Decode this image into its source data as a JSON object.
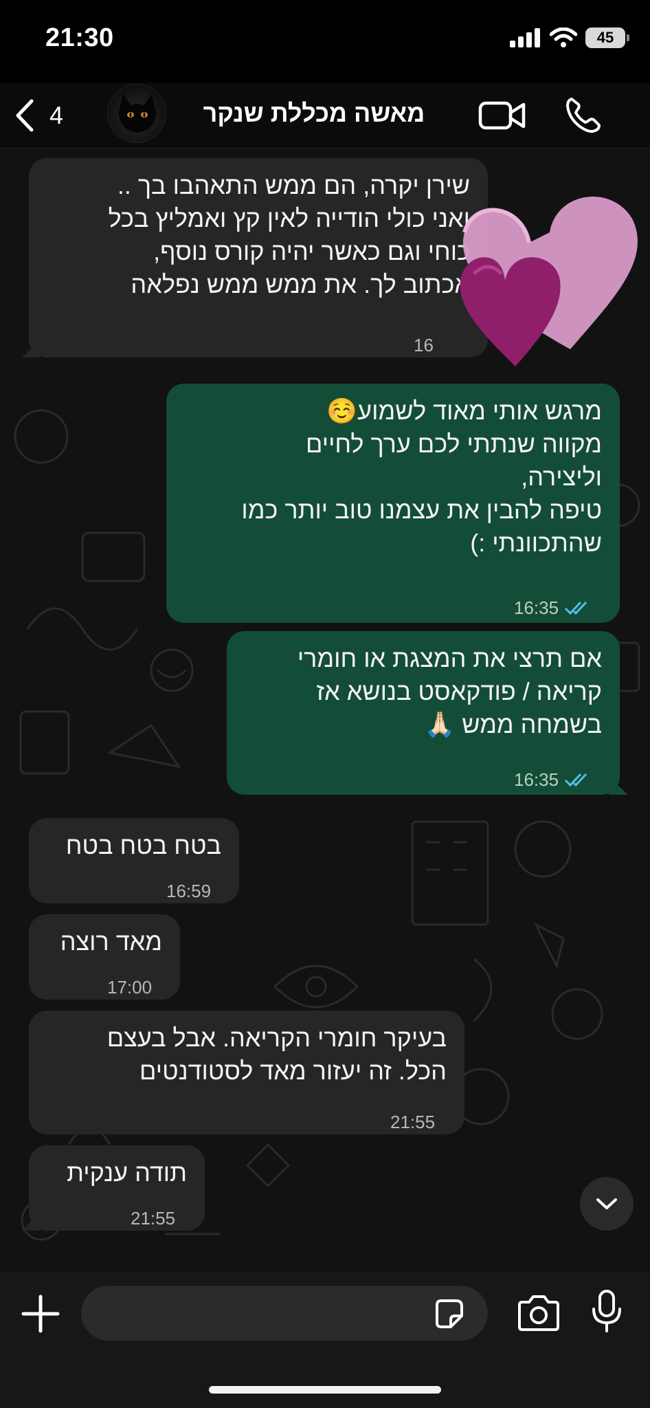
{
  "status_bar": {
    "time": "21:30",
    "battery": "45",
    "icons": [
      "signal-icon",
      "wifi-icon",
      "battery-icon"
    ]
  },
  "header": {
    "back_count": "4",
    "contact_name": "מאשה מכללת שנקר",
    "icons": [
      "chevron-left-icon",
      "video-call-icon",
      "phone-icon"
    ]
  },
  "messages": [
    {
      "direction": "in",
      "lines": [
        "שירן יקרה, הם ממש התאהבו בך ..",
        "ואני כולי הודייה לאין קץ ואמליץ בכל",
        "כוחי וגם כאשר יהיה קורס נוסף,",
        "אכתוב לך. את ממש ממש נפלאה"
      ],
      "time": "16"
    },
    {
      "direction": "out",
      "lines": [
        "מרגש אותי מאוד לשמוע☺️",
        "מקווה שנתתי לכם ערך לחיים",
        "וליצירה,",
        "טיפה להבין את עצמנו טוב יותר כמו",
        "שהתכוונתי :)"
      ],
      "time": "16:35",
      "status": "read"
    },
    {
      "direction": "out",
      "lines": [
        "אם תרצי את המצגת או חומרי",
        "קריאה / פודקאסט בנושא אז",
        "בשמחה ממש 🙏🏻"
      ],
      "time": "16:35",
      "status": "read"
    },
    {
      "direction": "in",
      "lines": [
        "בטח בטח בטח"
      ],
      "time": "16:59"
    },
    {
      "direction": "in",
      "lines": [
        "מאד רוצה"
      ],
      "time": "17:00"
    },
    {
      "direction": "in",
      "lines": [
        "בעיקר חומרי הקריאה. אבל בעצם",
        "הכל. זה יעזור מאד לסטודנטים"
      ],
      "time": "21:55"
    },
    {
      "direction": "in",
      "lines": [
        "תודה ענקית"
      ],
      "time": "21:55"
    }
  ],
  "composer": {
    "placeholder": ""
  },
  "colors": {
    "incoming_bubble": "#262626",
    "outgoing_bubble": "#144d37",
    "read_ticks": "#53bdeb",
    "background": "#0b0b0b"
  }
}
